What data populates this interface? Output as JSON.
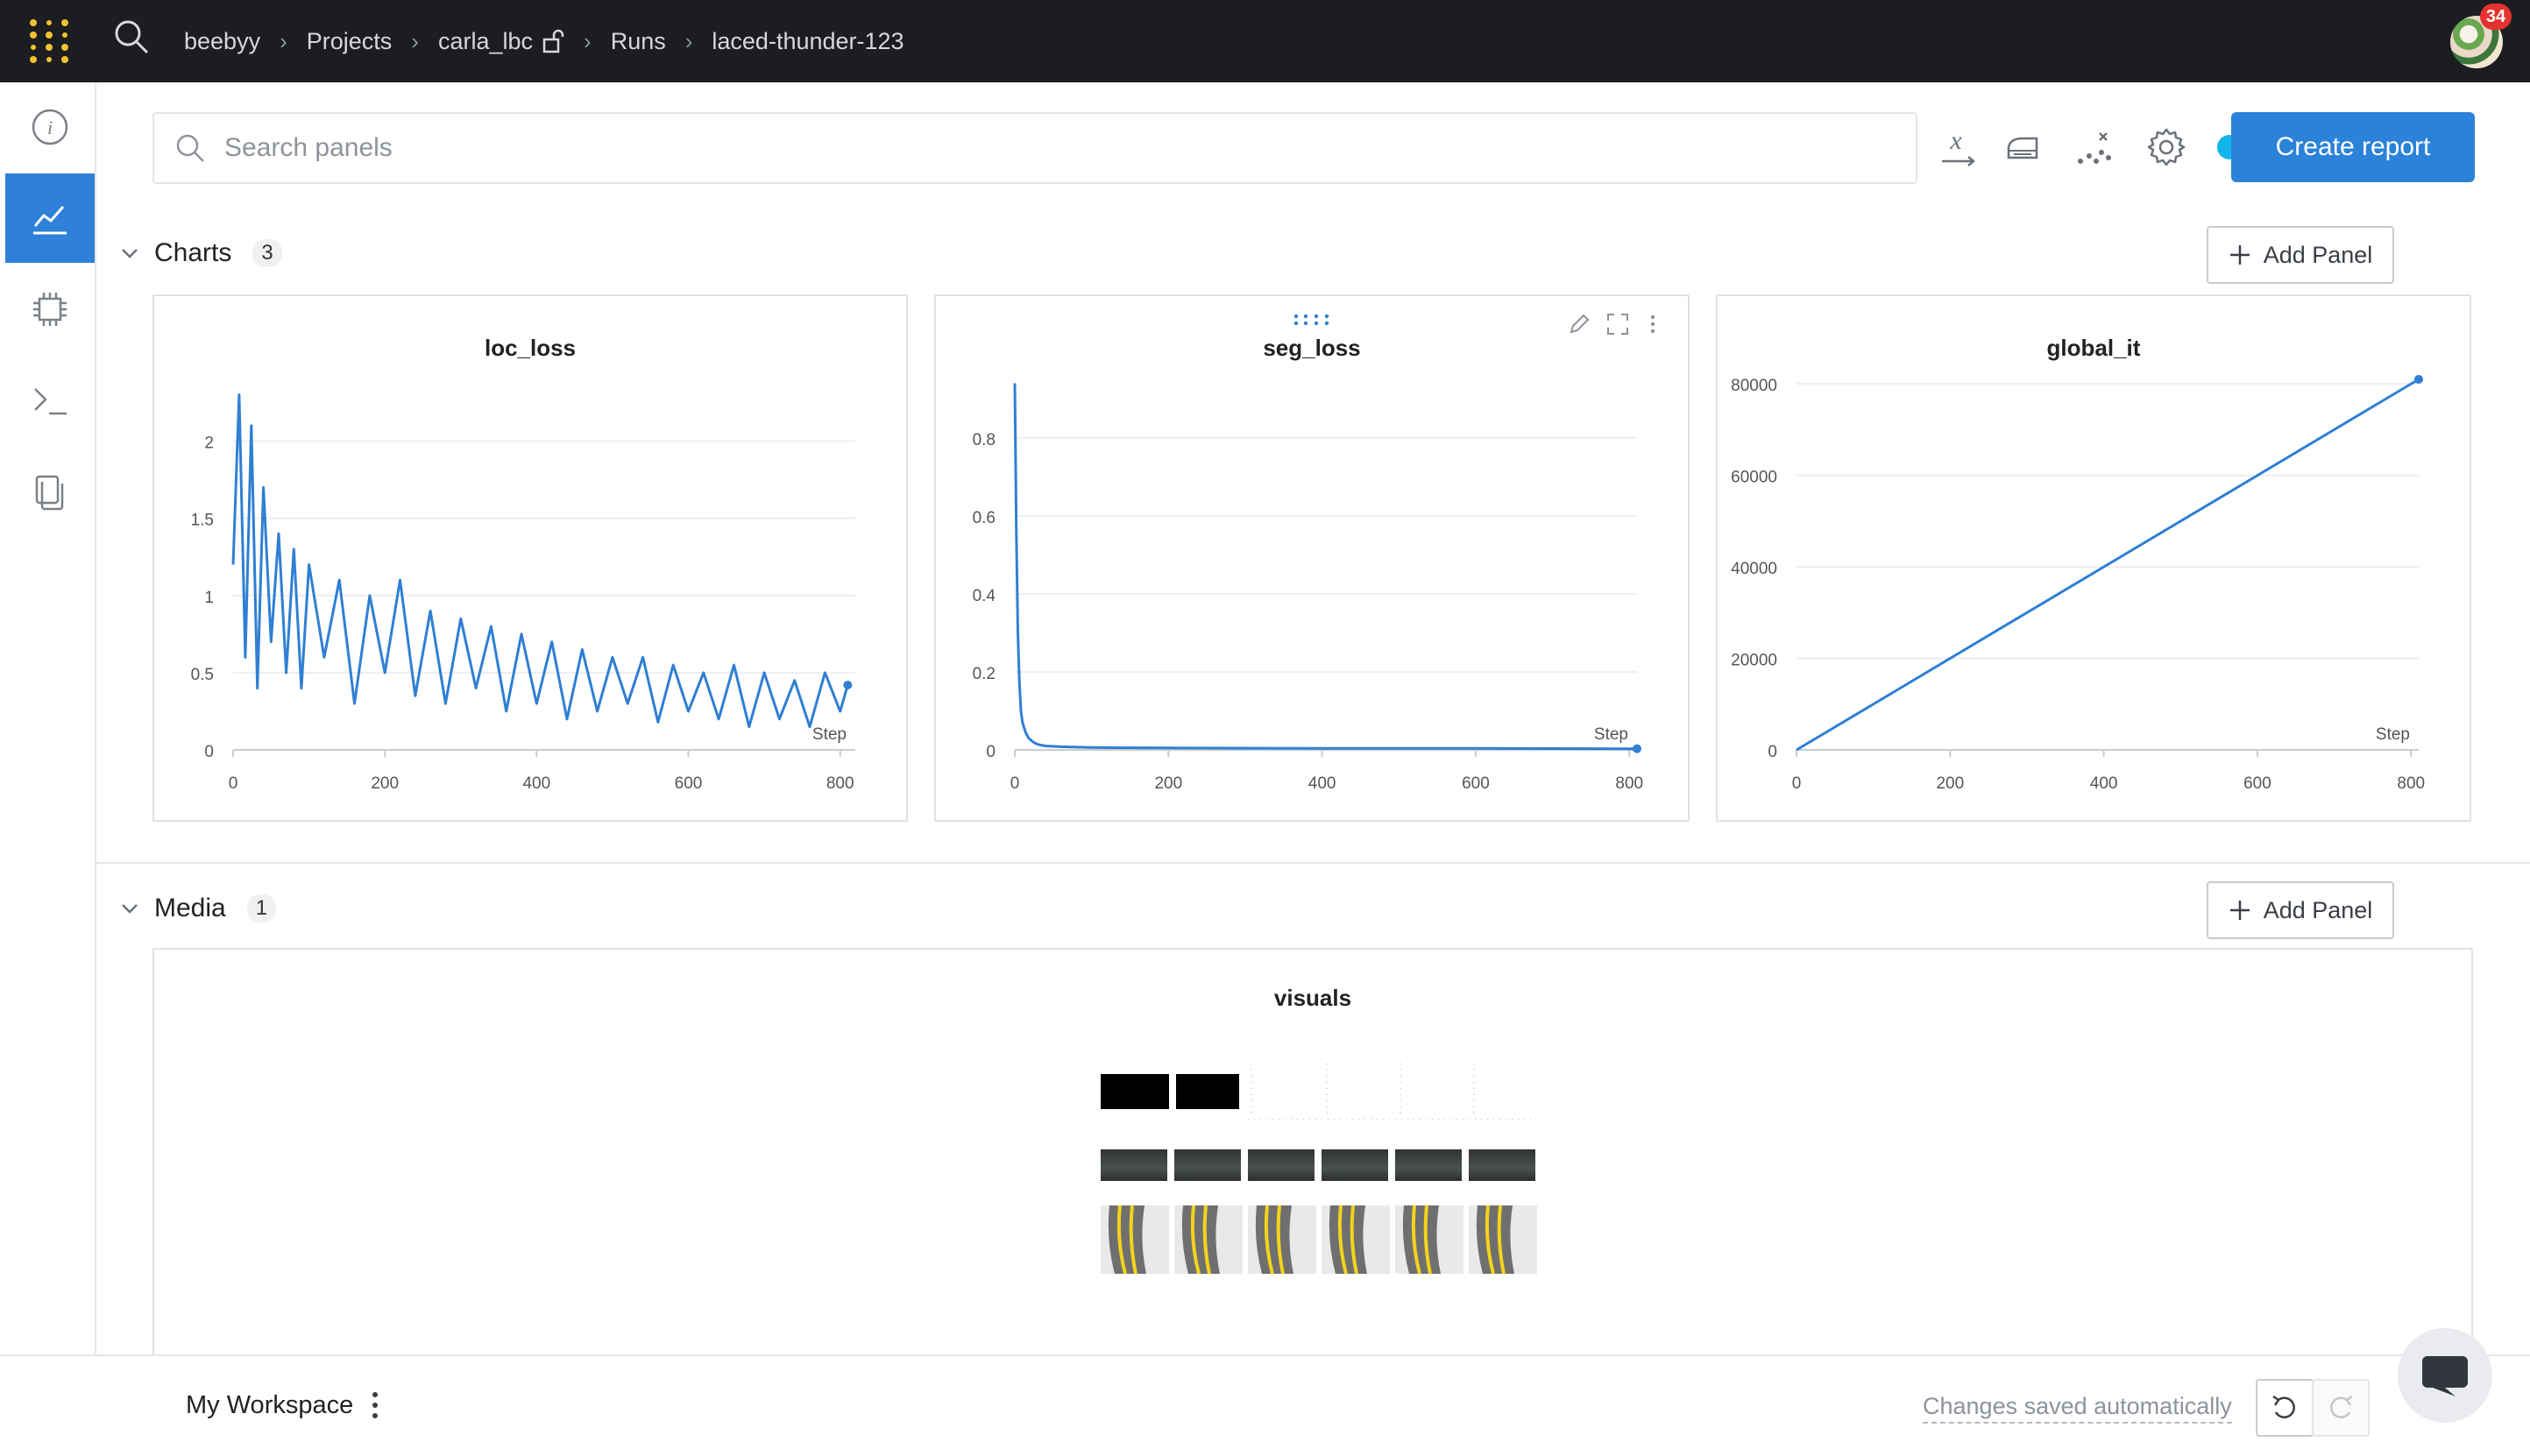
{
  "breadcrumbs": [
    "beebyy",
    "Projects",
    "carla_lbc",
    "Runs",
    "laced-thunder-123"
  ],
  "notifications": {
    "count": "34"
  },
  "search": {
    "placeholder": "Search panels",
    "value": ""
  },
  "toolbar": {
    "create_report_label": "Create report"
  },
  "sections": {
    "charts": {
      "title": "Charts",
      "count": "3",
      "add_label": "Add Panel"
    },
    "media": {
      "title": "Media",
      "count": "1",
      "add_label": "Add Panel"
    }
  },
  "media_panel": {
    "title": "visuals"
  },
  "footer": {
    "workspace": "My Workspace",
    "saved_status": "Changes saved automatically"
  },
  "colors": {
    "accent": "#2b82d9",
    "line": "#2f7fd3",
    "topbar": "#1b1d20"
  },
  "icons": [
    "logo-icon",
    "search-icon",
    "lock-icon",
    "info-icon",
    "charts-icon",
    "chip-icon",
    "terminal-icon",
    "files-icon",
    "x-axis-icon",
    "smoothing-icon",
    "outliers-icon",
    "settings-icon",
    "plus-icon",
    "chevron-down-icon",
    "undo-icon",
    "redo-icon",
    "chat-icon"
  ],
  "chart_data": [
    {
      "type": "line",
      "title": "loc_loss",
      "xlabel": "Step",
      "ylabel": "",
      "xlim": [
        0,
        820
      ],
      "ylim": [
        0,
        2.4
      ],
      "xticks": [
        "0",
        "200",
        "400",
        "600",
        "800"
      ],
      "yticks": [
        "0",
        "0.5",
        "1",
        "1.5",
        "2"
      ],
      "ytick_values": [
        0,
        0.5,
        1,
        1.5,
        2
      ],
      "grid": true,
      "series": [
        {
          "x": [
            0,
            8,
            16,
            24,
            32,
            40,
            50,
            60,
            70,
            80,
            90,
            100,
            120,
            140,
            160,
            180,
            200,
            220,
            240,
            260,
            280,
            300,
            320,
            340,
            360,
            380,
            400,
            420,
            440,
            460,
            480,
            500,
            520,
            540,
            560,
            580,
            600,
            620,
            640,
            660,
            680,
            700,
            720,
            740,
            760,
            780,
            800,
            810
          ],
          "values": [
            1.2,
            2.3,
            0.6,
            2.1,
            0.4,
            1.7,
            0.7,
            1.4,
            0.5,
            1.3,
            0.4,
            1.2,
            0.6,
            1.1,
            0.3,
            1.0,
            0.5,
            1.1,
            0.35,
            0.9,
            0.3,
            0.85,
            0.4,
            0.8,
            0.25,
            0.75,
            0.3,
            0.7,
            0.2,
            0.65,
            0.25,
            0.6,
            0.3,
            0.6,
            0.18,
            0.55,
            0.25,
            0.5,
            0.2,
            0.55,
            0.15,
            0.5,
            0.2,
            0.45,
            0.15,
            0.5,
            0.25,
            0.42
          ]
        }
      ]
    },
    {
      "type": "line",
      "title": "seg_loss",
      "xlabel": "Step",
      "ylabel": "",
      "xlim": [
        0,
        810
      ],
      "ylim": [
        0,
        0.95
      ],
      "xticks": [
        "0",
        "200",
        "400",
        "600",
        "800"
      ],
      "yticks": [
        "0",
        "0.2",
        "0.4",
        "0.6",
        "0.8"
      ],
      "ytick_values": [
        0,
        0.2,
        0.4,
        0.6,
        0.8
      ],
      "grid": true,
      "series": [
        {
          "x": [
            0,
            2,
            4,
            6,
            8,
            10,
            14,
            18,
            24,
            30,
            40,
            60,
            100,
            200,
            400,
            600,
            810
          ],
          "values": [
            0.94,
            0.55,
            0.3,
            0.17,
            0.1,
            0.07,
            0.045,
            0.03,
            0.02,
            0.014,
            0.01,
            0.008,
            0.006,
            0.005,
            0.004,
            0.004,
            0.003
          ]
        }
      ]
    },
    {
      "type": "line",
      "title": "global_it",
      "xlabel": "Step",
      "ylabel": "",
      "xlim": [
        0,
        810
      ],
      "ylim": [
        0,
        81000
      ],
      "xticks": [
        "0",
        "200",
        "400",
        "600",
        "800"
      ],
      "yticks": [
        "0",
        "20000",
        "40000",
        "60000",
        "80000"
      ],
      "ytick_values": [
        0,
        20000,
        40000,
        60000,
        80000
      ],
      "grid": true,
      "series": [
        {
          "x": [
            0,
            810
          ],
          "values": [
            0,
            81000
          ]
        }
      ]
    }
  ]
}
